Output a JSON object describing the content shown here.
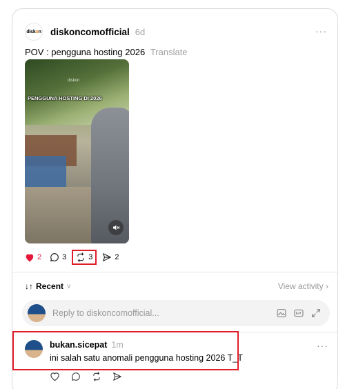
{
  "post": {
    "logo_text_a": "disk",
    "logo_text_o": "o",
    "logo_text_b": "n",
    "username": "diskoncomofficial",
    "time": "6d",
    "caption": "POV : pengguna hosting 2026",
    "translate_label": "Translate",
    "video_overlay_text": "PENGGUNA HOSTING DI 2026",
    "video_watermark": "diskon",
    "more_label": "···"
  },
  "actions": {
    "likes": "2",
    "comments": "3",
    "reposts": "3",
    "shares": "2",
    "like_color": "#e4163a"
  },
  "sort": {
    "label": "Recent",
    "view_activity": "View activity"
  },
  "reply": {
    "placeholder": "Reply to diskoncomofficial..."
  },
  "comment": {
    "username": "bukan.sicepat",
    "time": "1m",
    "text": "ini salah satu anomali pengguna hosting 2026 T_T",
    "more_label": "···"
  },
  "highlight_color": "#e11d2a"
}
